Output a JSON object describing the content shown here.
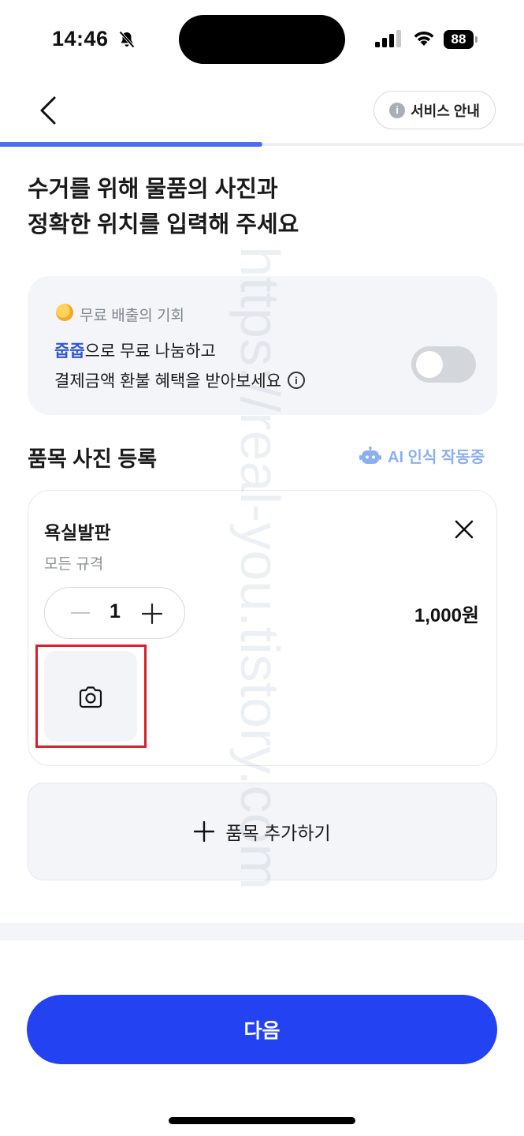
{
  "status_bar": {
    "time": "14:46",
    "battery": "88"
  },
  "header": {
    "service_label": "서비스 안내",
    "progress_fraction": 0.5
  },
  "title": "수거를 위해 물품의 사진과\n정확한 위치를 입력해 주세요",
  "promo": {
    "small_label": "무료 배출의 기회",
    "brand": "줍줍",
    "line1_rest": "으로 무료 나눔하고",
    "line2": "결제금액 환불 혜택을 받아보세요",
    "toggle_on": false
  },
  "section": {
    "title": "품목 사진 등록",
    "ai_label": "AI 인식 작동중"
  },
  "item": {
    "name": "욕실발판",
    "spec": "모든 규격",
    "quantity": "1",
    "price": "1,000원"
  },
  "add_item_label": "품목 추가하기",
  "next_label": "다음",
  "watermark": "https://real-you.tistory.com",
  "colors": {
    "accent": "#2342f2",
    "progress": "#4c6ef5",
    "brand_text": "#2f56d8",
    "highlight": "#d91f2a"
  }
}
